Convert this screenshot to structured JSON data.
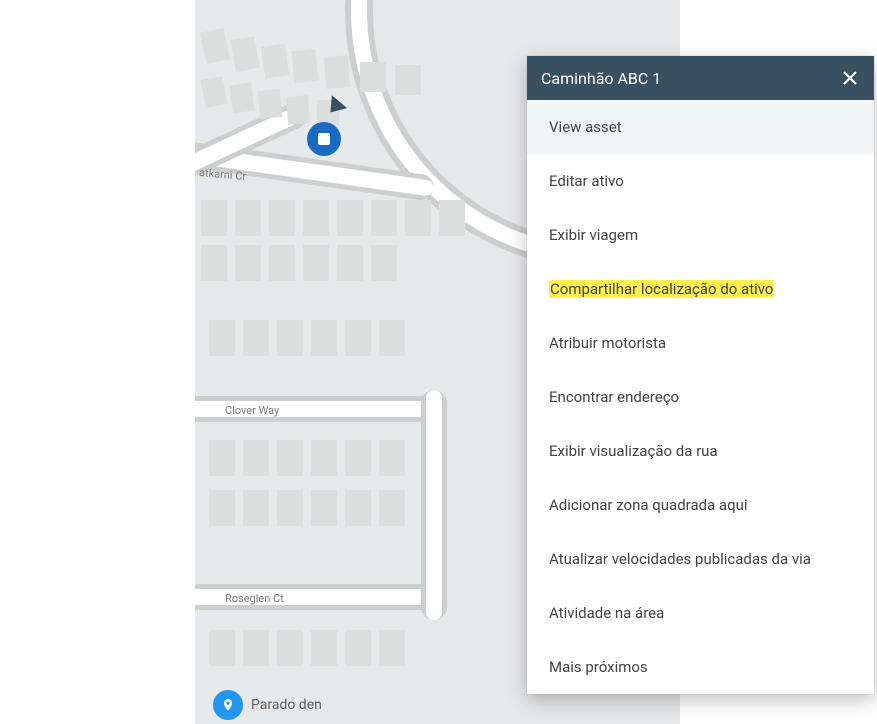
{
  "popup": {
    "title": "Caminhão ABC 1",
    "items": {
      "view_asset": "View asset",
      "edit_asset": "Editar ativo",
      "show_trip": "Exibir viagem",
      "share_location": "Compartilhar localização do ativo",
      "assign_driver": "Atribuir motorista",
      "find_address": "Encontrar endereço",
      "street_view": "Exibir visualização da rua",
      "add_zone": "Adicionar zona quadrada aqui",
      "update_speeds": "Atualizar velocidades publicadas da via",
      "area_activity": "Atividade na área",
      "nearest": "Mais próximos"
    }
  },
  "map": {
    "streets": {
      "atkarni": "atkarni Cr",
      "clover": "Clover Way",
      "roseglen": "Roseglen Ct"
    }
  },
  "status": {
    "text": "Parado den"
  }
}
